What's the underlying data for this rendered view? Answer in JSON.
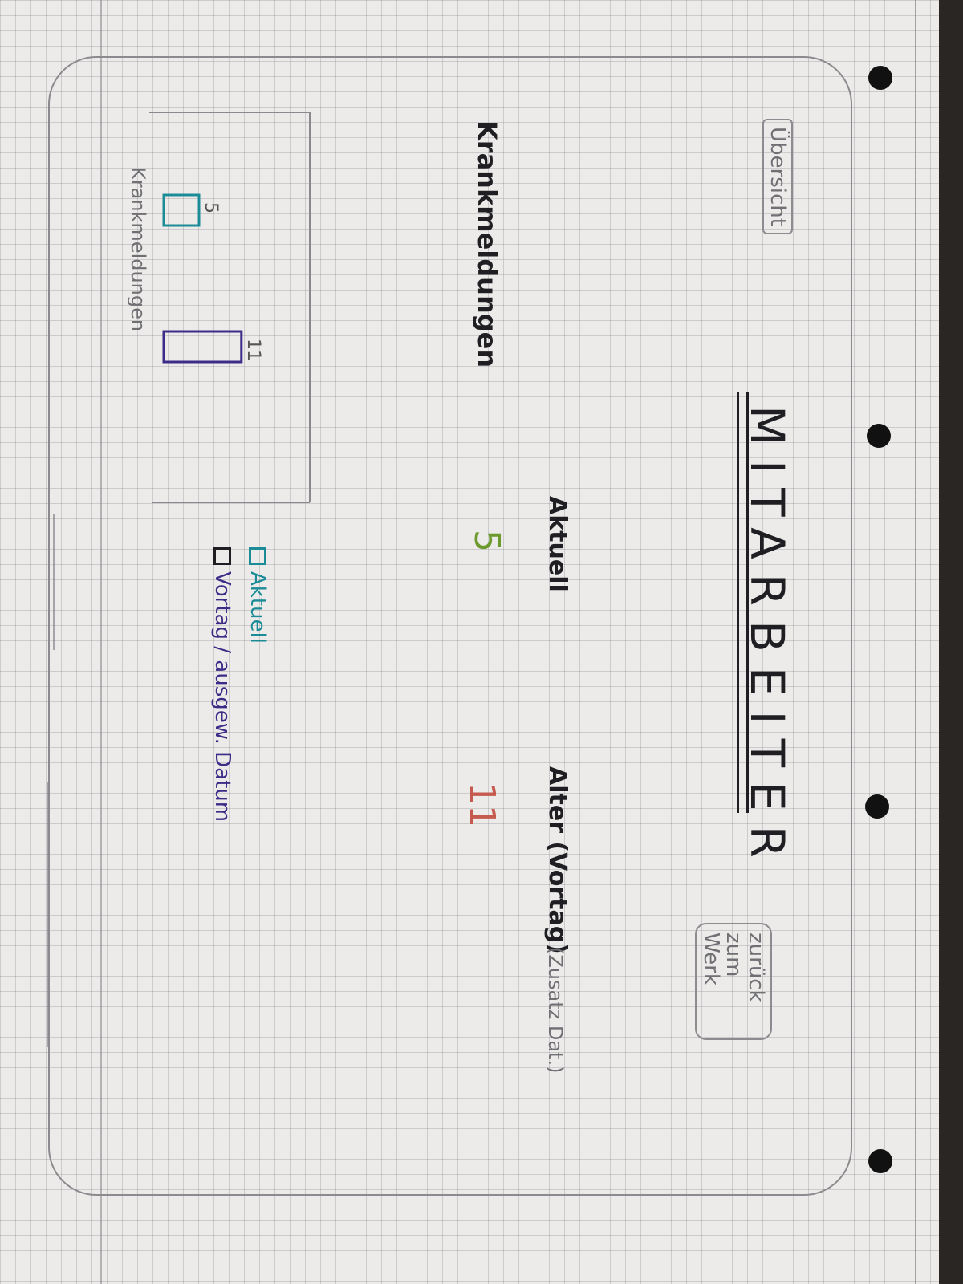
{
  "header": {
    "overview_tab": "Übersicht",
    "title": "MITARBEITER",
    "back_button": "zurück zum Werk"
  },
  "stats": {
    "current": {
      "label": "Aktuell",
      "value": "5",
      "color": "#6d9a2c"
    },
    "age": {
      "label": "Alter (Vortag)",
      "note": "(Zusatz Dat.)",
      "value": "11",
      "color": "#c65a4e"
    }
  },
  "sick_chart": {
    "section_title": "Krankmeldungen",
    "axis_label": "Krankmeldungen",
    "legend": [
      {
        "label": "Aktuell",
        "color": "#1b8c97",
        "checked": false
      },
      {
        "label": "Vortag / ausgew. Datum",
        "color": "#3d2b87",
        "checked": false
      }
    ]
  },
  "chart_data": {
    "type": "bar",
    "categories": [
      "Aktuell",
      "Vortag / ausgew. Datum"
    ],
    "series": [
      {
        "values": [
          5,
          11
        ],
        "colors": [
          "#1b8c97",
          "#3d2b87"
        ]
      }
    ],
    "data_labels": [
      "5",
      "11"
    ],
    "ylabel": "Krankmeldungen",
    "ylim": [
      0,
      20
    ]
  }
}
